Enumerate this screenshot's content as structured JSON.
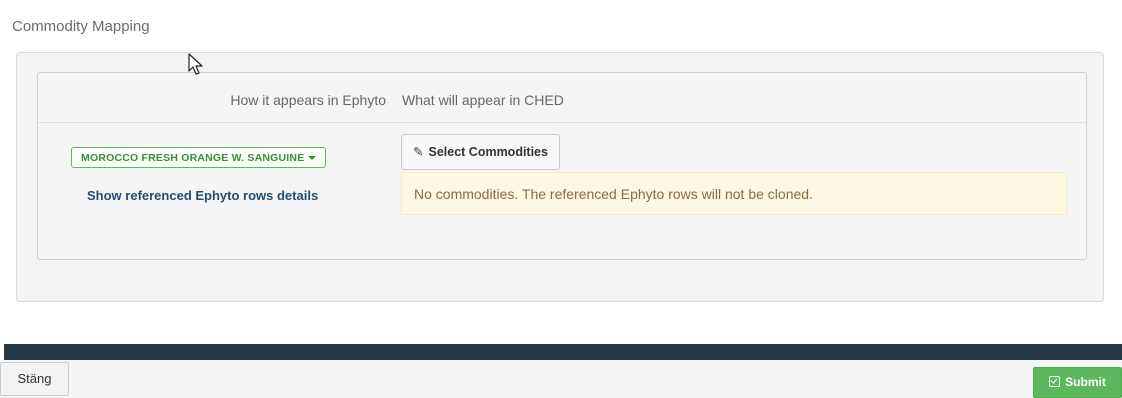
{
  "section": {
    "title": "Commodity Mapping"
  },
  "mapping": {
    "header_ephyto": "How it appears in Ephyto",
    "header_ched": "What will appear in CHED",
    "commodity_label": "MOROCCO FRESH ORANGE W. SANGUINE",
    "show_details_link": "Show referenced Ephyto rows details",
    "select_button_label": "Select Commodities",
    "select_button_icon": "pencil-icon",
    "alert_message": "No commodities. The referenced Ephyto rows will not be cloned."
  },
  "footer": {
    "close_label": "Stäng",
    "submit_label": "Submit",
    "submit_icon": "check-square-icon"
  },
  "colors": {
    "dark_bar": "#253745",
    "success_green": "#5cb85c",
    "link_blue": "#1f4e79",
    "alert_bg": "#fcf8e3",
    "alert_text": "#8a6d3b"
  }
}
